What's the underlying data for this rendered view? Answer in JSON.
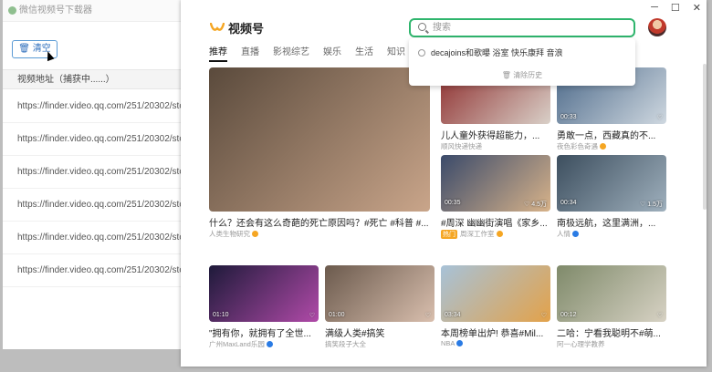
{
  "downloader": {
    "title": "微信视频号下载器",
    "clear_button": "清空",
    "column_header": "视频地址（捕获中......）",
    "rows": [
      "https://finder.video.qq.com/251/20302/stodow",
      "https://finder.video.qq.com/251/20302/stodow",
      "https://finder.video.qq.com/251/20302/stodow",
      "https://finder.video.qq.com/251/20302/stodow",
      "https://finder.video.qq.com/251/20302/stodow",
      "https://finder.video.qq.com/251/20302/stodow"
    ]
  },
  "window_controls": {
    "minimize": "─",
    "maximize": "☐",
    "close": "✕"
  },
  "app": {
    "brand": "视频号"
  },
  "search": {
    "placeholder": "搜索"
  },
  "search_dropdown": {
    "history_item": "decajoins和歌曝 浴室 快乐康拜 音浪",
    "clear_history": "清除历史"
  },
  "tabs": [
    "推荐",
    "直播",
    "影视综艺",
    "娱乐",
    "生活",
    "知识"
  ],
  "cards": [
    {
      "title": "什么？还会有这么奇葩的死亡原因吗？#死亡 #科普 #...",
      "author": "人类生物研究",
      "verified": "orange",
      "duration": "",
      "likes": "",
      "colors": [
        "#5a4a3c",
        "#c9a58a"
      ]
    },
    {
      "title": "儿人童外获得超能力，...",
      "author": "顺风快递快递",
      "verified": "none",
      "duration": "",
      "likes": "",
      "colors": [
        "#8e2e2e",
        "#d9d0c8"
      ]
    },
    {
      "title": "勇敢一点，西藏真的不...",
      "author": "夜色彩色奇遇",
      "verified": "orange",
      "duration": "00:33",
      "likes": "",
      "colors": [
        "#4d6a8a",
        "#cfd8e0"
      ]
    },
    {
      "title": "#周深 幽幽街演唱《家乡...",
      "author": "周深工作室",
      "verified": "orange",
      "duration": "00:35",
      "likes": "4.5万",
      "colors": [
        "#3a4a6a",
        "#d8b38a"
      ]
    },
    {
      "title": "南极远航，这里满洲，...",
      "author": "人情",
      "verified": "blue",
      "duration": "00:34",
      "likes": "1.5万",
      "colors": [
        "#3c4e5e",
        "#9fb0bd"
      ]
    },
    {
      "title": "\"拥有你，就拥有了全世...",
      "author": "广州MaxLand乐园",
      "verified": "blue",
      "duration": "01:10",
      "likes": "",
      "colors": [
        "#1e1a3a",
        "#b04aa8"
      ]
    },
    {
      "title": "满级人类#搞笑",
      "author": "搞笑段子大全",
      "verified": "none",
      "duration": "01:00",
      "likes": "",
      "colors": [
        "#6b5a4d",
        "#d9bfae"
      ]
    },
    {
      "title": "本周榜单出炉! 恭喜#Mil...",
      "author": "NBA",
      "verified": "blue",
      "duration": "03:34",
      "likes": "",
      "colors": [
        "#a7c2d8",
        "#e3a24a"
      ]
    },
    {
      "title": "二哈：宁看我聪明不#萌...",
      "author": "阿一心理学教养",
      "verified": "none",
      "duration": "00:12",
      "likes": "",
      "colors": [
        "#7f8a6a",
        "#d7d2c4"
      ]
    }
  ],
  "badge_text": "热门",
  "badge_author": "嘉苗传播",
  "colors": {
    "accent": "#2fb56d",
    "verified_orange": "#f5a623",
    "verified_blue": "#2a7be4"
  }
}
